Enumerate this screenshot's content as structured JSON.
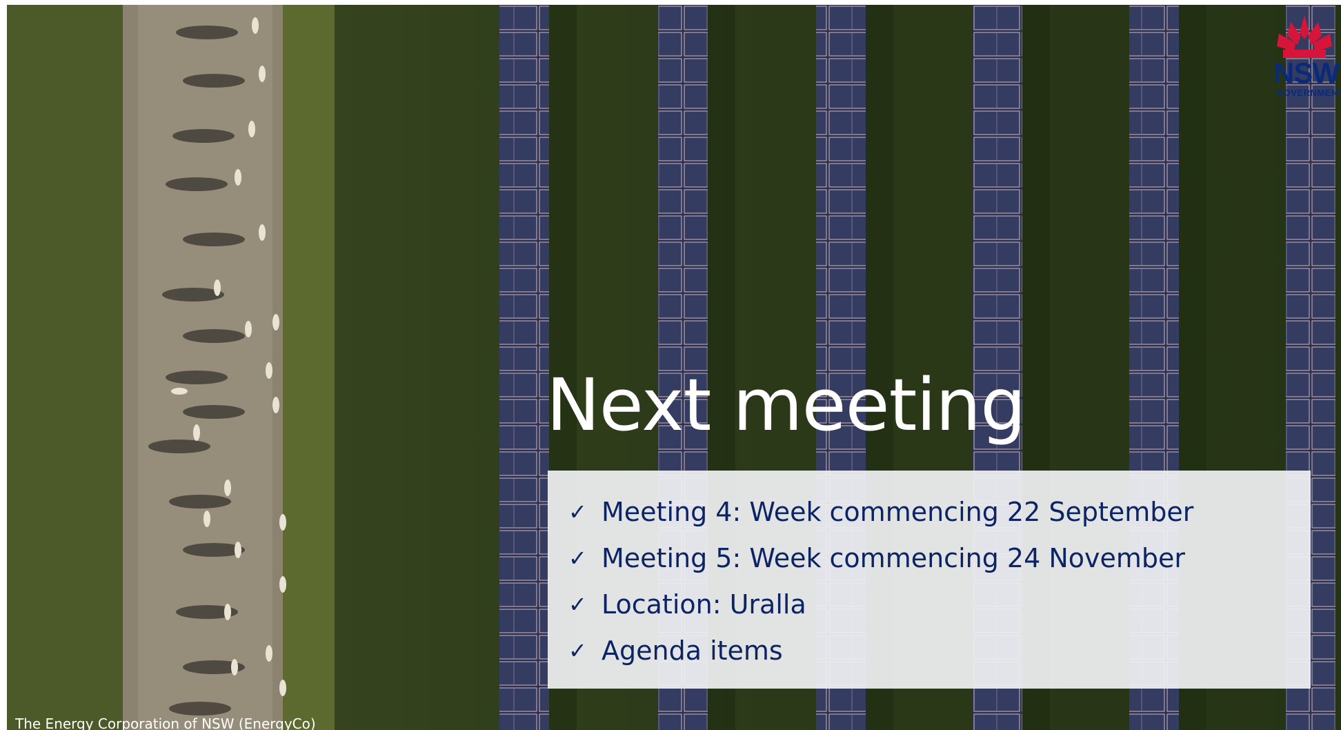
{
  "slide": {
    "title": "Next meeting",
    "items": [
      {
        "check_icon": "✓",
        "text": "Meeting 4: Week commencing 22 September"
      },
      {
        "check_icon": "✓",
        "text": "Meeting 5: Week commencing 24 November"
      },
      {
        "check_icon": "✓",
        "text": "Location: Uralla"
      },
      {
        "check_icon": "✓",
        "text": "Agenda items"
      }
    ],
    "photo_credit": "The Energy Corporation of NSW (EnergyCo)"
  },
  "logo": {
    "text": "NSW",
    "subtext": "GOVERNMENT",
    "colors": {
      "waratah": "#d7153a",
      "text": "#0a2a7a"
    }
  },
  "colors": {
    "title": "#ffffff",
    "panel": "#f0f1f3",
    "item_text": "#0d2464"
  }
}
